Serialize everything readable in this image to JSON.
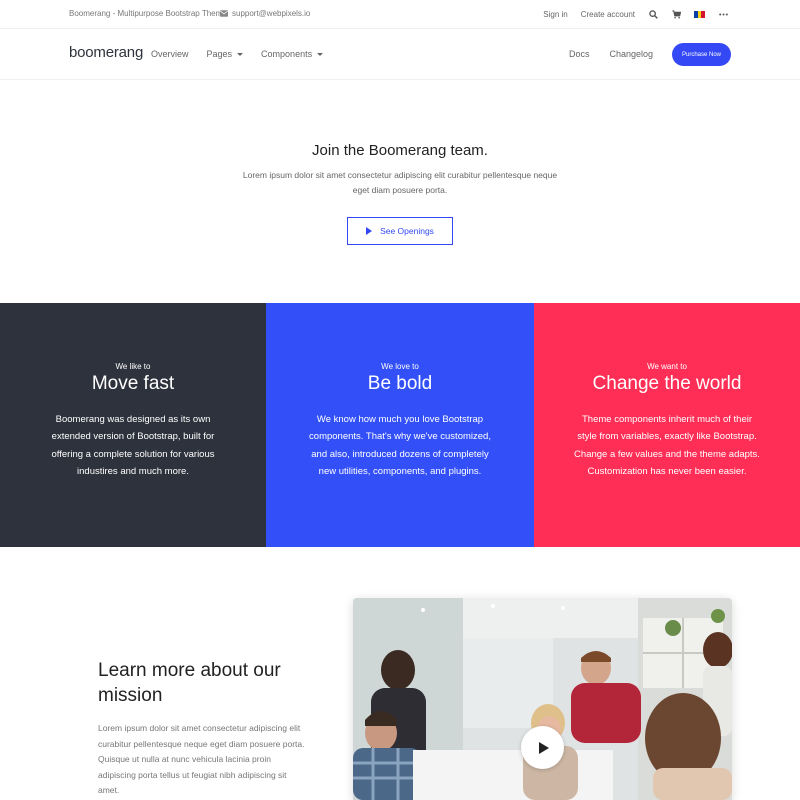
{
  "topbar": {
    "site_title": "Boomerang - Multipurpose Bootstrap Theme",
    "email": "support@webpixels.io",
    "sign_in": "Sign in",
    "create_account": "Create account"
  },
  "navbar": {
    "logo": "boomerang",
    "items": [
      "Overview",
      "Pages",
      "Components"
    ],
    "right_items": [
      "Docs",
      "Changelog"
    ],
    "purchase": "Purchase Now"
  },
  "hero": {
    "title": "Join the Boomerang team.",
    "text": "Lorem ipsum dolor sit amet consectetur adipiscing elit curabitur pellentesque neque eget diam posuere porta.",
    "button": "See Openings"
  },
  "features": [
    {
      "eyebrow": "We like to",
      "title": "Move fast",
      "text": "Boomerang was designed as its own extended version of Bootstrap, built for offering a complete solution for various industires and much more."
    },
    {
      "eyebrow": "We love to",
      "title": "Be bold",
      "text": "We know how much you love Bootstrap components. That's why we've customized, and also, introduced dozens of completely new utilities, components, and plugins."
    },
    {
      "eyebrow": "We want to",
      "title": "Change the world",
      "text": "Theme components inherit much of their style from variables, exactly like Bootstrap. Change a few values and the theme adapts. Customization has never been easier."
    }
  ],
  "mission": {
    "title": "Learn more about our mission",
    "text": "Lorem ipsum dolor sit amet consectetur adipiscing elit curabitur pellentesque neque eget diam posuere porta. Quisque ut nulla at nunc vehicula lacinia proin adipiscing porta tellus ut feugiat nibh adipiscing sit amet."
  },
  "colors": {
    "primary": "#3449f5",
    "dark": "#2e323c",
    "blue": "#3350f8",
    "pink": "#ff2e56"
  }
}
